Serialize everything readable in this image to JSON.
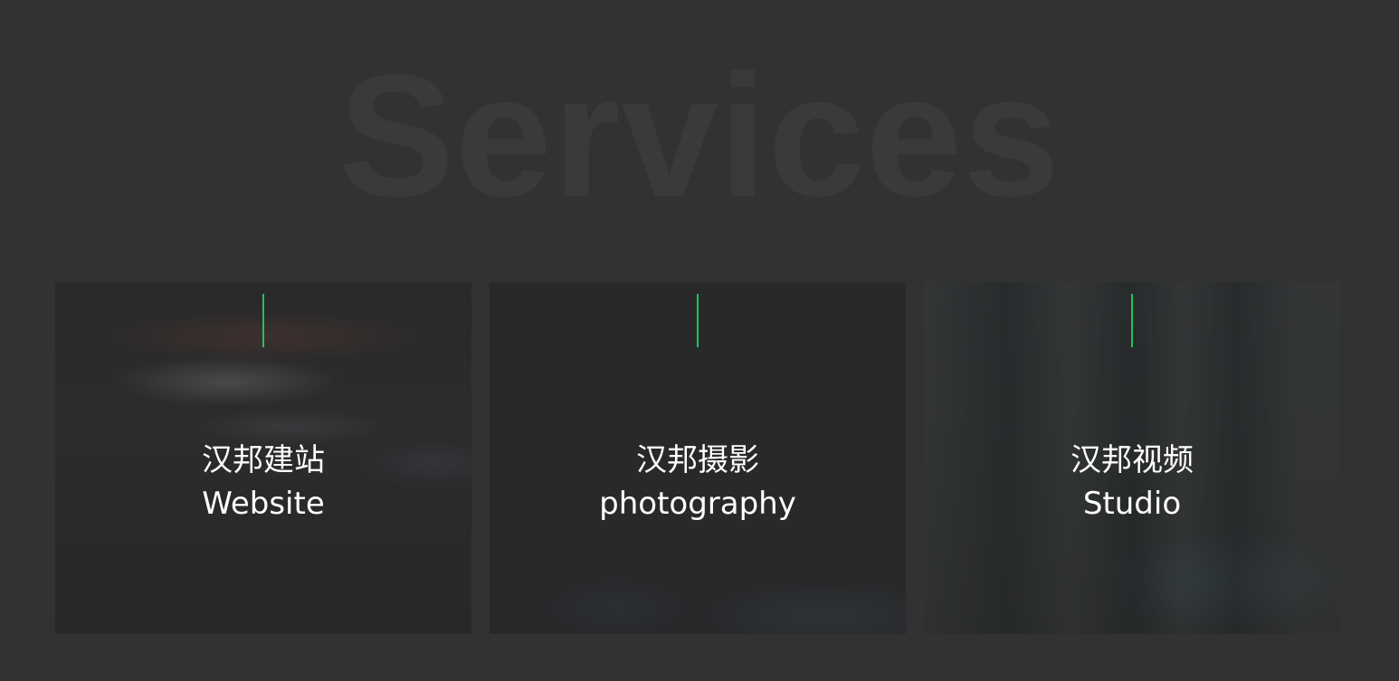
{
  "section": {
    "watermark_title": "Services"
  },
  "cards": [
    {
      "title_cn": "汉邦建站",
      "title_en": "Website"
    },
    {
      "title_cn": "汉邦摄影",
      "title_en": "photography"
    },
    {
      "title_cn": "汉邦视频",
      "title_en": "Studio"
    }
  ],
  "colors": {
    "background": "#323232",
    "watermark": "#3a3a3a",
    "accent": "#21c35f",
    "text": "#ffffff"
  }
}
